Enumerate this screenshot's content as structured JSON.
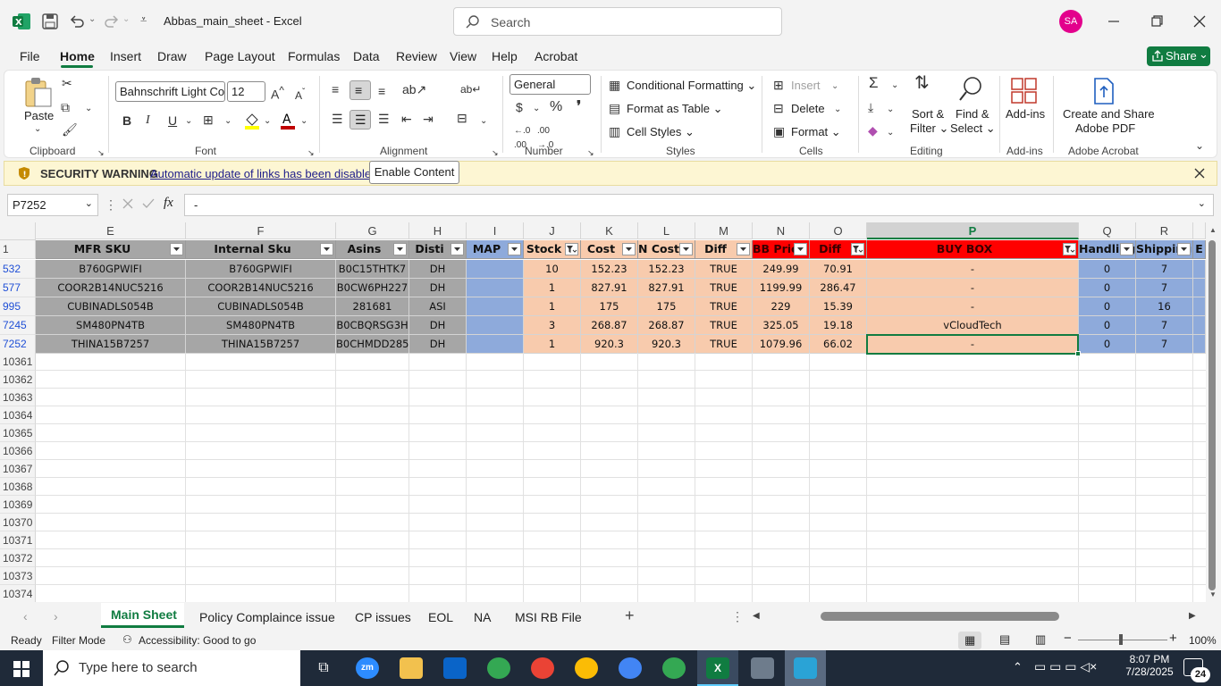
{
  "app": {
    "file_title": "Abbas_main_sheet",
    "app_name": "Excel",
    "title_sep": " - ",
    "search_placeholder": "Search",
    "user_initials": "SA"
  },
  "menu_tabs": [
    "File",
    "Home",
    "Insert",
    "Draw",
    "Page Layout",
    "Formulas",
    "Data",
    "Review",
    "View",
    "Help",
    "Acrobat"
  ],
  "share_label": "Share",
  "ribbon": {
    "paste": "Paste",
    "clipboard": "Clipboard",
    "font_name": "Bahnschrift Light Co",
    "font_size": "12",
    "font": "Font",
    "alignment": "Alignment",
    "number_format": "General",
    "number": "Number",
    "conditional_formatting": "Conditional Formatting",
    "format_as_table": "Format as Table",
    "cell_styles": "Cell Styles",
    "styles": "Styles",
    "insert": "Insert",
    "delete": "Delete",
    "format": "Format",
    "cells": "Cells",
    "sort_filter_1": "Sort &",
    "sort_filter_2": "Filter",
    "find_select_1": "Find &",
    "find_select_2": "Select",
    "editing": "Editing",
    "addins": "Add-ins",
    "addins_group": "Add-ins",
    "create_pdf_1": "Create and Share",
    "create_pdf_2": "Adobe PDF",
    "adobe_acrobat": "Adobe Acrobat"
  },
  "security": {
    "label": "SECURITY WARNING",
    "message": "Automatic update of links has been disabled",
    "button": "Enable Content"
  },
  "formula_bar": {
    "name_box": "P7252",
    "fx": "fx",
    "value": "-"
  },
  "sheet": {
    "columns": [
      "E",
      "F",
      "G",
      "H",
      "I",
      "J",
      "K",
      "L",
      "M",
      "N",
      "O",
      "P",
      "Q",
      "R"
    ],
    "header_row_num": "1",
    "headers": [
      "MFR SKU",
      "Internal Sku",
      "Asins",
      "Disti",
      "MAP",
      "Stock",
      "Cost",
      "N Cost",
      "Diff",
      "BB Price",
      "Diff",
      "BUY BOX",
      "Handling",
      "Shipping"
    ],
    "rows": [
      {
        "num": "532",
        "cells": [
          "B760GPWIFI",
          "B760GPWIFI",
          "B0C15THTK7",
          "DH",
          "",
          "10",
          "152.23",
          "152.23",
          "TRUE",
          "249.99",
          "70.91",
          "-",
          "0",
          "7"
        ]
      },
      {
        "num": "577",
        "cells": [
          "COOR2B14NUC5216",
          "COOR2B14NUC5216",
          "B0CW6PH227",
          "DH",
          "",
          "1",
          "827.91",
          "827.91",
          "TRUE",
          "1199.99",
          "286.47",
          "-",
          "0",
          "7"
        ]
      },
      {
        "num": "995",
        "cells": [
          "CUBINADLS054B",
          "CUBINADLS054B",
          "281681",
          "ASI",
          "",
          "1",
          "175",
          "175",
          "TRUE",
          "229",
          "15.39",
          "-",
          "0",
          "16"
        ]
      },
      {
        "num": "7245",
        "cells": [
          "SM480PN4TB",
          "SM480PN4TB",
          "B0CBQRSG3H",
          "DH",
          "",
          "3",
          "268.87",
          "268.87",
          "TRUE",
          "325.05",
          "19.18",
          "vCloudTech",
          "0",
          "7"
        ]
      },
      {
        "num": "7252",
        "cells": [
          "THINA15B7257",
          "THINA15B7257",
          "B0CHMDD285",
          "DH",
          "",
          "1",
          "920.3",
          "920.3",
          "TRUE",
          "1079.96",
          "66.02",
          "-",
          "0",
          "7"
        ]
      }
    ],
    "empty_rows": [
      "10361",
      "10362",
      "10363",
      "10364",
      "10365",
      "10366",
      "10367",
      "10368",
      "10369",
      "10370",
      "10371",
      "10372",
      "10373",
      "10374"
    ]
  },
  "sheet_tabs": [
    "Main Sheet",
    "Policy Complaince issue",
    "CP issues",
    "EOL",
    "NA",
    "MSI RB File"
  ],
  "status": {
    "ready": "Ready",
    "filter_mode": "Filter Mode",
    "accessibility": "Accessibility: Good to go",
    "zoom": "100%"
  },
  "taskbar": {
    "search_placeholder": "Type here to search",
    "time": "8:07 PM",
    "date": "7/28/2025",
    "notifications": "24"
  },
  "colors": {
    "accent": "#107c41",
    "gray_fill": "#a6a6a6",
    "blue_fill": "#8eaadb",
    "peach_fill": "#f8cbad",
    "red_fill": "#ff0000"
  }
}
